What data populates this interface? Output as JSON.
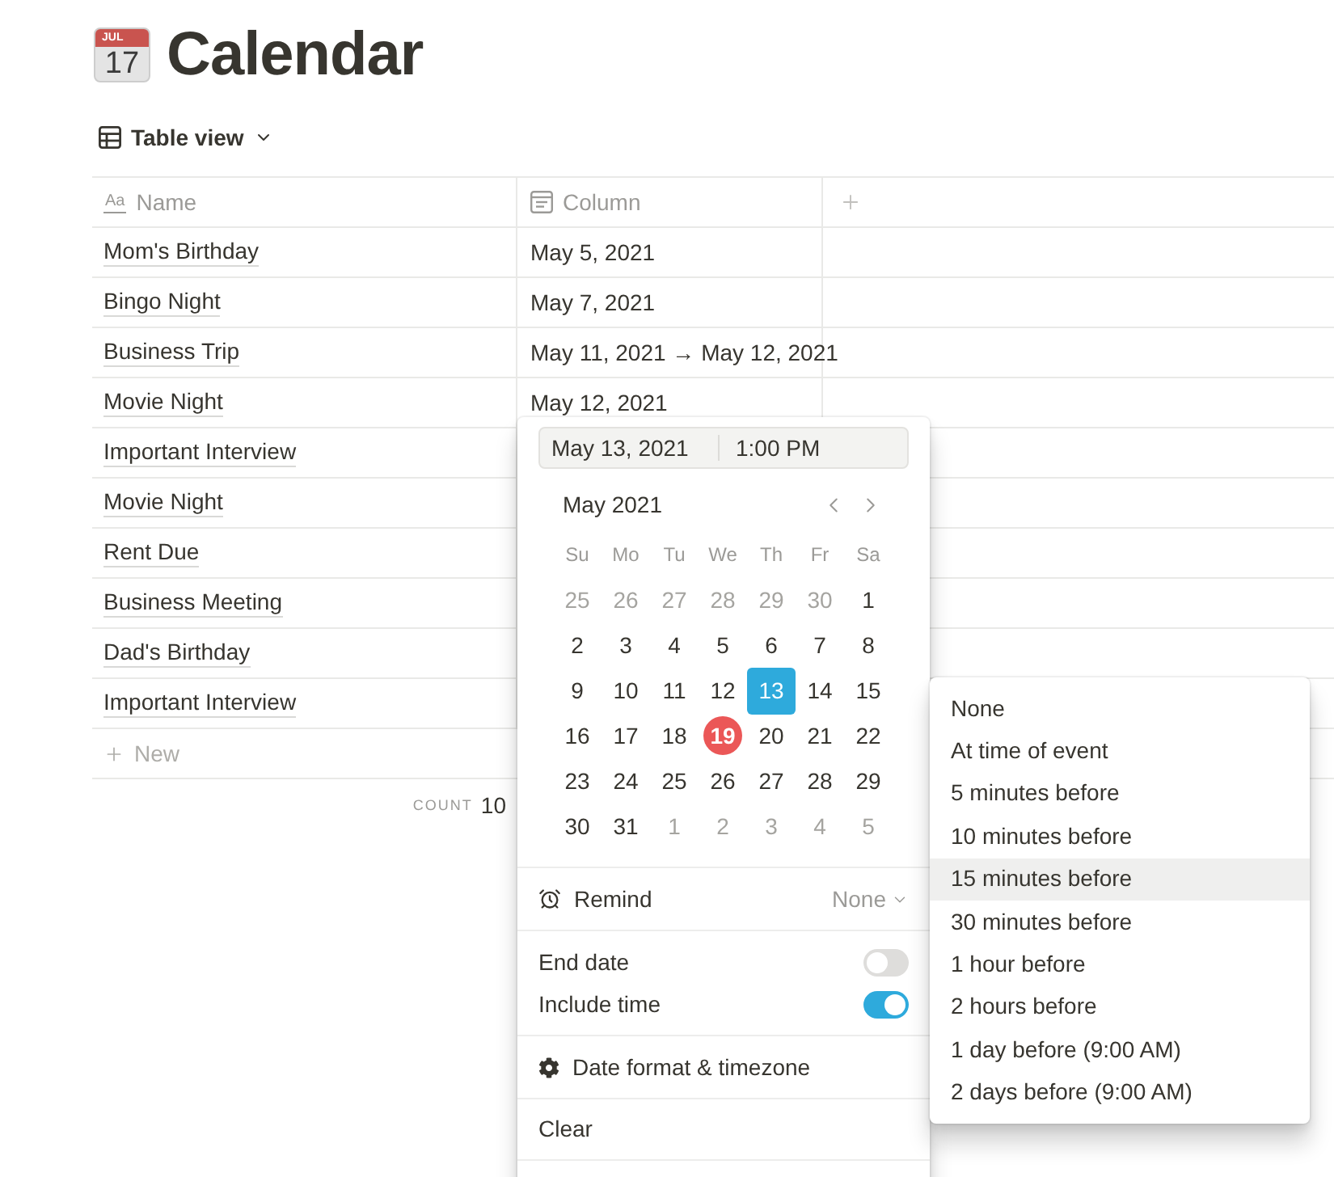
{
  "page": {
    "icon": {
      "month": "JUL",
      "day": "17"
    },
    "title": "Calendar"
  },
  "view": {
    "label": "Table view"
  },
  "table": {
    "columns": [
      {
        "kind": "title",
        "glyph": "Aa",
        "label": "Name"
      },
      {
        "kind": "date",
        "label": "Column"
      },
      {
        "kind": "add"
      }
    ],
    "rows": [
      {
        "name": "Mom's Birthday",
        "date": "May 5, 2021"
      },
      {
        "name": "Bingo Night",
        "date": "May 7, 2021"
      },
      {
        "name": "Business Trip",
        "date": "May 11, 2021 → May 12, 2021"
      },
      {
        "name": "Movie Night",
        "date": "May 12, 2021"
      },
      {
        "name": "Important Interview"
      },
      {
        "name": "Movie Night"
      },
      {
        "name": "Rent Due"
      },
      {
        "name": "Business Meeting"
      },
      {
        "name": "Dad's Birthday"
      },
      {
        "name": "Important Interview"
      }
    ],
    "new_row": "New",
    "count_label": "COUNT",
    "count": "10"
  },
  "date_picker": {
    "start_date": "May 13, 2021",
    "start_time": "1:00 PM",
    "month": "May 2021",
    "weekdays": [
      "Su",
      "Mo",
      "Tu",
      "We",
      "Th",
      "Fr",
      "Sa"
    ],
    "days": [
      {
        "day": "25",
        "outside": true,
        "selected": false,
        "today": false
      },
      {
        "day": "26",
        "outside": true,
        "selected": false,
        "today": false
      },
      {
        "day": "27",
        "outside": true,
        "selected": false,
        "today": false
      },
      {
        "day": "28",
        "outside": true,
        "selected": false,
        "today": false
      },
      {
        "day": "29",
        "outside": true,
        "selected": false,
        "today": false
      },
      {
        "day": "30",
        "outside": true,
        "selected": false,
        "today": false
      },
      {
        "day": "1",
        "outside": false,
        "selected": false,
        "today": false
      },
      {
        "day": "2",
        "outside": false,
        "selected": false,
        "today": false
      },
      {
        "day": "3",
        "outside": false,
        "selected": false,
        "today": false
      },
      {
        "day": "4",
        "outside": false,
        "selected": false,
        "today": false
      },
      {
        "day": "5",
        "outside": false,
        "selected": false,
        "today": false
      },
      {
        "day": "6",
        "outside": false,
        "selected": false,
        "today": false
      },
      {
        "day": "7",
        "outside": false,
        "selected": false,
        "today": false
      },
      {
        "day": "8",
        "outside": false,
        "selected": false,
        "today": false
      },
      {
        "day": "9",
        "outside": false,
        "selected": false,
        "today": false
      },
      {
        "day": "10",
        "outside": false,
        "selected": false,
        "today": false
      },
      {
        "day": "11",
        "outside": false,
        "selected": false,
        "today": false
      },
      {
        "day": "12",
        "outside": false,
        "selected": false,
        "today": false
      },
      {
        "day": "13",
        "outside": false,
        "selected": true,
        "today": false
      },
      {
        "day": "14",
        "outside": false,
        "selected": false,
        "today": false
      },
      {
        "day": "15",
        "outside": false,
        "selected": false,
        "today": false
      },
      {
        "day": "16",
        "outside": false,
        "selected": false,
        "today": false
      },
      {
        "day": "17",
        "outside": false,
        "selected": false,
        "today": false
      },
      {
        "day": "18",
        "outside": false,
        "selected": false,
        "today": false
      },
      {
        "day": "19",
        "outside": false,
        "selected": false,
        "today": true
      },
      {
        "day": "20",
        "outside": false,
        "selected": false,
        "today": false
      },
      {
        "day": "21",
        "outside": false,
        "selected": false,
        "today": false
      },
      {
        "day": "22",
        "outside": false,
        "selected": false,
        "today": false
      },
      {
        "day": "23",
        "outside": false,
        "selected": false,
        "today": false
      },
      {
        "day": "24",
        "outside": false,
        "selected": false,
        "today": false
      },
      {
        "day": "25",
        "outside": false,
        "selected": false,
        "today": false
      },
      {
        "day": "26",
        "outside": false,
        "selected": false,
        "today": false
      },
      {
        "day": "27",
        "outside": false,
        "selected": false,
        "today": false
      },
      {
        "day": "28",
        "outside": false,
        "selected": false,
        "today": false
      },
      {
        "day": "29",
        "outside": false,
        "selected": false,
        "today": false
      },
      {
        "day": "30",
        "outside": false,
        "selected": false,
        "today": false
      },
      {
        "day": "31",
        "outside": false,
        "selected": false,
        "today": false
      },
      {
        "day": "1",
        "outside": true,
        "selected": false,
        "today": false
      },
      {
        "day": "2",
        "outside": true,
        "selected": false,
        "today": false
      },
      {
        "day": "3",
        "outside": true,
        "selected": false,
        "today": false
      },
      {
        "day": "4",
        "outside": true,
        "selected": false,
        "today": false
      },
      {
        "day": "5",
        "outside": true,
        "selected": false,
        "today": false
      }
    ],
    "remind": {
      "label": "Remind",
      "value": "None"
    },
    "toggles": [
      {
        "label": "End date",
        "on": false
      },
      {
        "label": "Include time",
        "on": true
      }
    ],
    "format_label": "Date format & timezone",
    "clear_label": "Clear"
  },
  "remind_menu": {
    "items": [
      {
        "label": "None",
        "highlighted": false
      },
      {
        "label": "At time of event",
        "highlighted": false
      },
      {
        "label": "5 minutes before",
        "highlighted": false
      },
      {
        "label": "10 minutes before",
        "highlighted": false
      },
      {
        "label": "15 minutes before",
        "highlighted": true
      },
      {
        "label": "30 minutes before",
        "highlighted": false
      },
      {
        "label": "1 hour before",
        "highlighted": false
      },
      {
        "label": "2 hours before",
        "highlighted": false
      },
      {
        "label": "1 day before (9:00 AM)",
        "highlighted": false
      },
      {
        "label": "2 days before (9:00 AM)",
        "highlighted": false
      }
    ]
  }
}
